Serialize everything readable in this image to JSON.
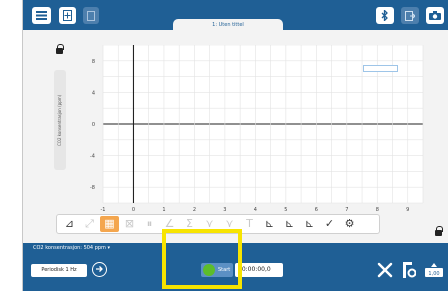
{
  "header": {
    "tab_title": "1: Uten tittel"
  },
  "graph": {
    "y_axis_title": "CO2 konsentrasjon (ppm)",
    "y_ticks": [
      "8",
      "4",
      "0",
      "-4",
      "-8"
    ],
    "x_ticks": [
      "-1",
      "0",
      "1",
      "2",
      "3",
      "4",
      "5",
      "6",
      "7",
      "8",
      "9"
    ]
  },
  "toolbar": {
    "tools": [
      {
        "name": "chart-tool-icon",
        "glyph": "⊿",
        "state": "en"
      },
      {
        "name": "fullscreen-icon",
        "glyph": "⤢",
        "state": "dis"
      },
      {
        "name": "data-table-icon",
        "glyph": "▦",
        "state": "sel"
      },
      {
        "name": "delete-icon",
        "glyph": "⊠",
        "state": "dis"
      },
      {
        "name": "pause-icon",
        "glyph": "⏸",
        "state": "dis"
      },
      {
        "name": "tangent-icon",
        "glyph": "∠",
        "state": "dis"
      },
      {
        "name": "sum-icon",
        "glyph": "Σ",
        "state": "dis"
      },
      {
        "name": "curve-fit-icon",
        "glyph": "⋎",
        "state": "dis"
      },
      {
        "name": "linear-fit-icon",
        "glyph": "⋎",
        "state": "dis"
      },
      {
        "name": "text-icon",
        "glyph": "T",
        "state": "dis"
      },
      {
        "name": "axis-scale-icon",
        "glyph": "⊾",
        "state": "en"
      },
      {
        "name": "axis-zoom-icon",
        "glyph": "⊾",
        "state": "en"
      },
      {
        "name": "axis-autoscale-icon",
        "glyph": "⊾",
        "state": "en"
      },
      {
        "name": "check-icon",
        "glyph": "✓",
        "state": "en"
      },
      {
        "name": "settings-gear-icon",
        "glyph": "⚙",
        "state": "en"
      }
    ]
  },
  "sensor": {
    "label": "CO2 konsentrasjon: 504  ppm ▾"
  },
  "controls": {
    "periodic_label": "Periodisk 1 Hz",
    "start_label": "Start",
    "timer_value": "00:00:00,0"
  },
  "colors": {
    "bar": "#1f5f95",
    "highlight": "#f7e400",
    "start_dot": "#5cbd2a",
    "selected_tool": "#f4a64e"
  }
}
